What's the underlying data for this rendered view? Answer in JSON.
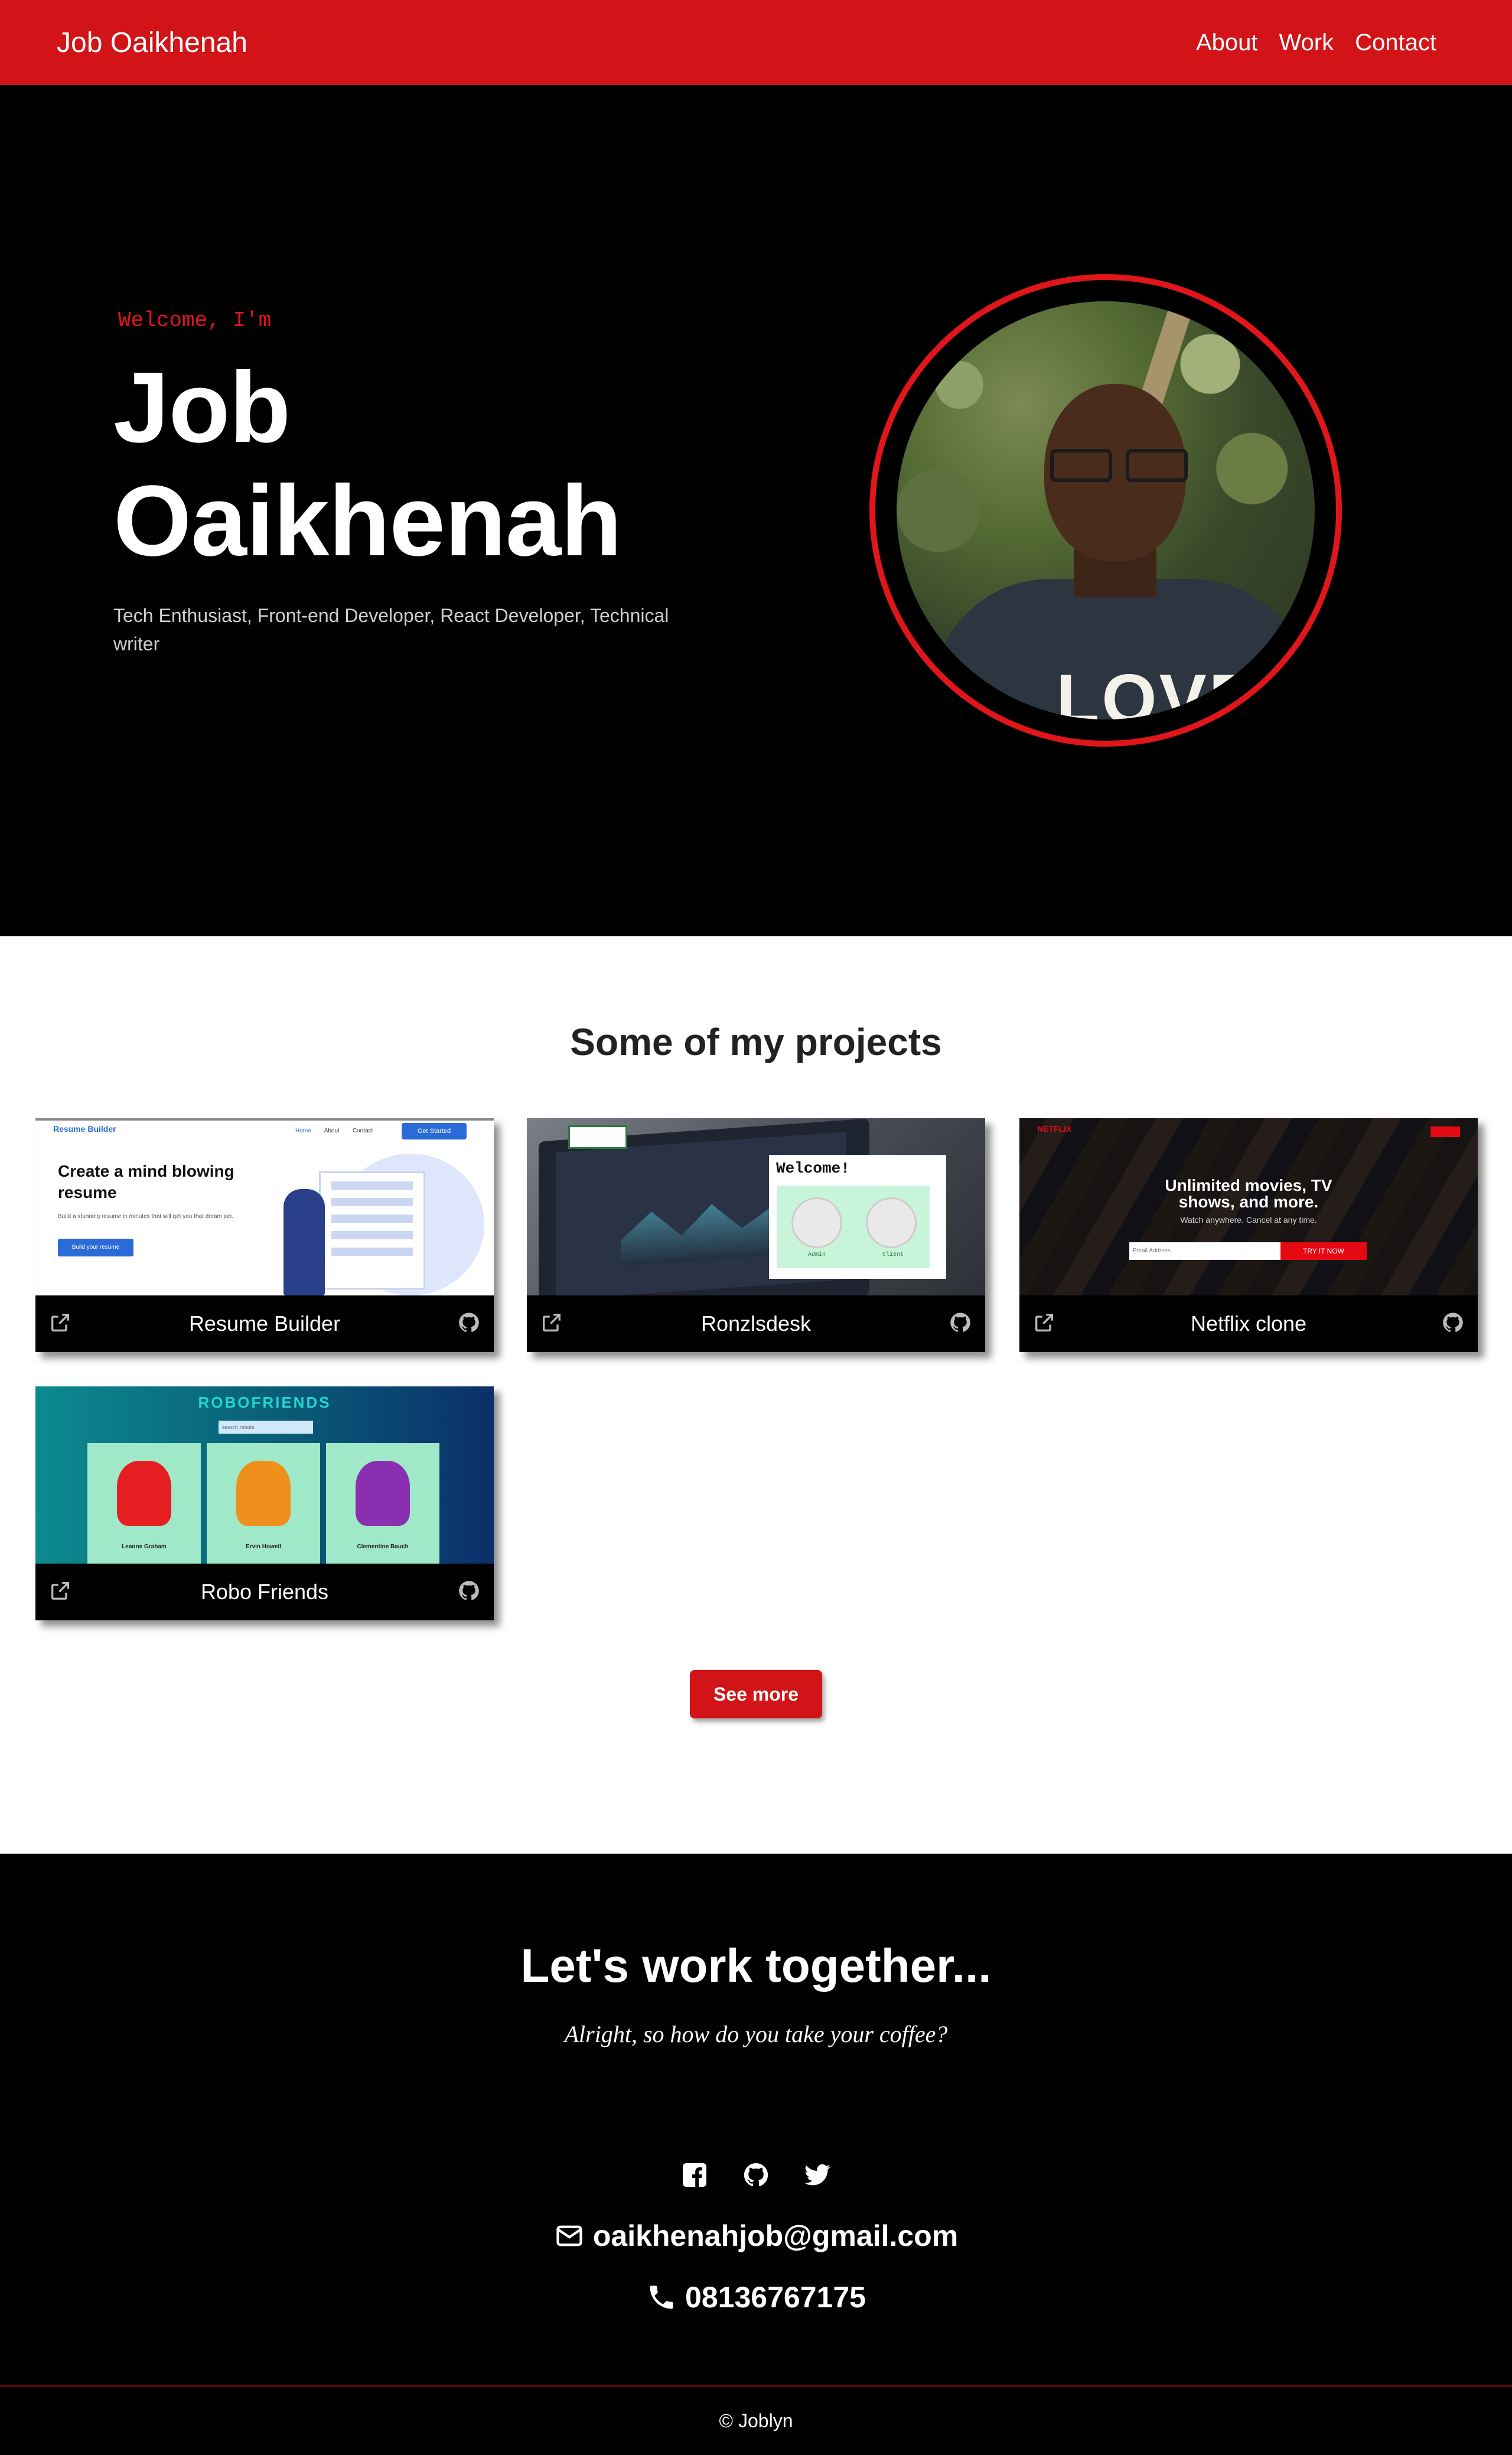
{
  "nav": {
    "brand": "Job Oaikhenah",
    "links": [
      "About",
      "Work",
      "Contact"
    ]
  },
  "hero": {
    "greeting": "Welcome, I'm",
    "name_first": "Job",
    "name_last": "Oaikhenah",
    "subtitle": "Tech Enthusiast, Front-end Developer, React Developer, Technical writer",
    "portrait_shirt_text": "LOVE"
  },
  "projects": {
    "title": "Some of my projects",
    "items": [
      {
        "title": "Resume Builder",
        "thumb": {
          "logo": "Resume Builder",
          "links": [
            "Home",
            "About",
            "Contact"
          ],
          "cta": "Get Started",
          "headline": "Create a mind blowing resume",
          "text": "Build a stunning resume in minutes that will get you that dream job.",
          "button": "Build your resume"
        }
      },
      {
        "title": "Ronzlsdesk",
        "thumb": {
          "welcome": "Welcome!",
          "avatar_labels": [
            "Admin",
            "Client"
          ]
        }
      },
      {
        "title": "Netflix clone",
        "thumb": {
          "logo": "NETFLIX",
          "headline": "Unlimited movies, TV shows, and more.",
          "subline": "Watch anywhere. Cancel at any time.",
          "input_placeholder": "Email Address",
          "button": "TRY IT NOW"
        }
      },
      {
        "title": "Robo Friends",
        "thumb": {
          "logo": "ROBOFRIENDS",
          "search_placeholder": "search robots",
          "robots": [
            "Leanne Graham",
            "Ervin Howell",
            "Clementine Bauch"
          ]
        }
      }
    ],
    "see_more": "See more"
  },
  "contact": {
    "title": "Let's work together...",
    "quote": "Alright, so how do you take your coffee?",
    "socials": [
      "facebook-icon",
      "github-icon",
      "twitter-icon"
    ],
    "email": "oaikhenahjob@gmail.com",
    "phone": "08136767175"
  },
  "footer": {
    "text": "© Joblyn"
  },
  "colors": {
    "accent": "#d21317",
    "hero_bg": "#000000",
    "welcome_text": "#e0161b"
  }
}
